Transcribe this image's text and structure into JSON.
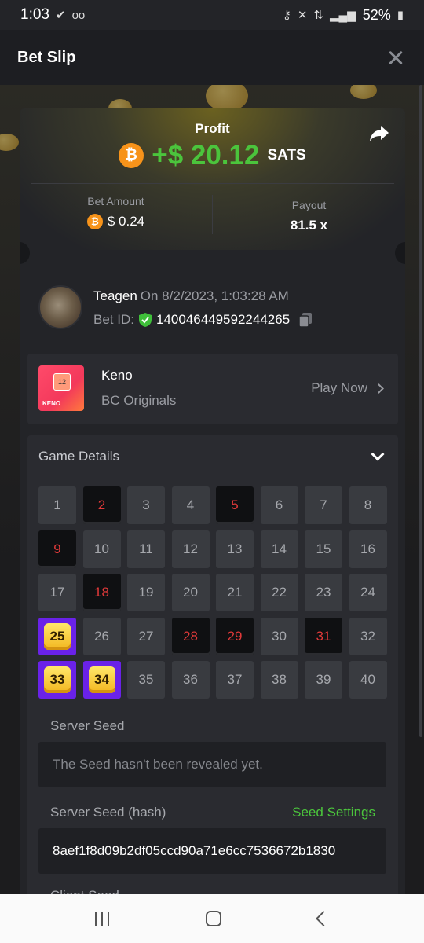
{
  "status_bar": {
    "time": "1:03",
    "battery": "52%"
  },
  "header": {
    "title": "Bet Slip"
  },
  "profit": {
    "label": "Profit",
    "amount": "+$ 20.12",
    "unit": "SATS",
    "bet_amount_label": "Bet Amount",
    "bet_amount": "$ 0.24",
    "payout_label": "Payout",
    "payout": "81.5 x"
  },
  "user": {
    "name": "Teagen",
    "on_text": "On 8/2/2023, 1:03:28 AM",
    "bet_id_label": "Bet ID:",
    "bet_id": "140046449592244265"
  },
  "game": {
    "thumb_number": "12",
    "thumb_label": "KENO",
    "name": "Keno",
    "provider": "BC Originals",
    "play_label": "Play Now"
  },
  "details": {
    "header": "Game Details",
    "cells": [
      {
        "n": "1",
        "s": "normal"
      },
      {
        "n": "2",
        "s": "hit"
      },
      {
        "n": "3",
        "s": "normal"
      },
      {
        "n": "4",
        "s": "normal"
      },
      {
        "n": "5",
        "s": "hit"
      },
      {
        "n": "6",
        "s": "normal"
      },
      {
        "n": "7",
        "s": "normal"
      },
      {
        "n": "8",
        "s": "normal"
      },
      {
        "n": "9",
        "s": "hit"
      },
      {
        "n": "10",
        "s": "normal"
      },
      {
        "n": "11",
        "s": "normal"
      },
      {
        "n": "12",
        "s": "normal"
      },
      {
        "n": "13",
        "s": "normal"
      },
      {
        "n": "14",
        "s": "normal"
      },
      {
        "n": "15",
        "s": "normal"
      },
      {
        "n": "16",
        "s": "normal"
      },
      {
        "n": "17",
        "s": "normal"
      },
      {
        "n": "18",
        "s": "hit"
      },
      {
        "n": "19",
        "s": "normal"
      },
      {
        "n": "20",
        "s": "normal"
      },
      {
        "n": "21",
        "s": "normal"
      },
      {
        "n": "22",
        "s": "normal"
      },
      {
        "n": "23",
        "s": "normal"
      },
      {
        "n": "24",
        "s": "normal"
      },
      {
        "n": "25",
        "s": "win"
      },
      {
        "n": "26",
        "s": "normal"
      },
      {
        "n": "27",
        "s": "normal"
      },
      {
        "n": "28",
        "s": "hit"
      },
      {
        "n": "29",
        "s": "hit"
      },
      {
        "n": "30",
        "s": "normal"
      },
      {
        "n": "31",
        "s": "hit"
      },
      {
        "n": "32",
        "s": "normal"
      },
      {
        "n": "33",
        "s": "win"
      },
      {
        "n": "34",
        "s": "win"
      },
      {
        "n": "35",
        "s": "normal"
      },
      {
        "n": "36",
        "s": "normal"
      },
      {
        "n": "37",
        "s": "normal"
      },
      {
        "n": "38",
        "s": "normal"
      },
      {
        "n": "39",
        "s": "normal"
      },
      {
        "n": "40",
        "s": "normal"
      }
    ],
    "server_seed_label": "Server Seed",
    "server_seed_value": "The Seed hasn't been revealed yet.",
    "server_seed_hash_label": "Server Seed (hash)",
    "seed_settings_label": "Seed Settings",
    "server_seed_hash_value": "8aef1f8d09b2df05ccd90a71e6cc7536672b1830",
    "client_seed_label": "Client Seed"
  },
  "colors": {
    "accent_green": "#4bc43c",
    "hit_red": "#e23a3a",
    "win_purple": "#6a22e8",
    "btc_orange": "#f7931a"
  }
}
